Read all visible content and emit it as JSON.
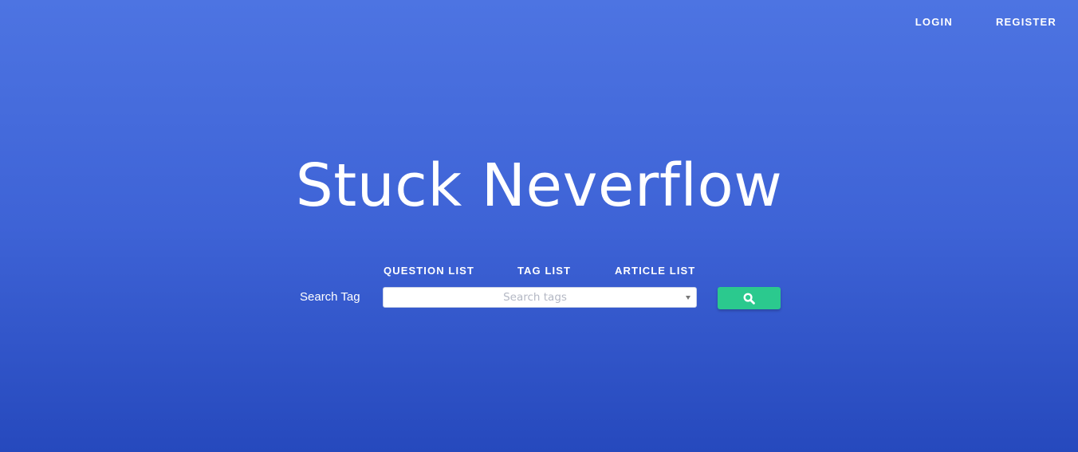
{
  "header": {
    "login_label": "LOGIN",
    "register_label": "REGISTER"
  },
  "hero": {
    "title": "Stuck Neverflow"
  },
  "nav": {
    "question_list": "QUESTION LIST",
    "tag_list": "TAG LIST",
    "article_list": "ARTICLE LIST"
  },
  "search": {
    "label": "Search Tag",
    "placeholder": "Search tags",
    "value": "",
    "button_icon": "search-icon"
  },
  "colors": {
    "background_top": "#4d74e2",
    "background_bottom": "#2649bd",
    "button": "#2bc98e"
  }
}
